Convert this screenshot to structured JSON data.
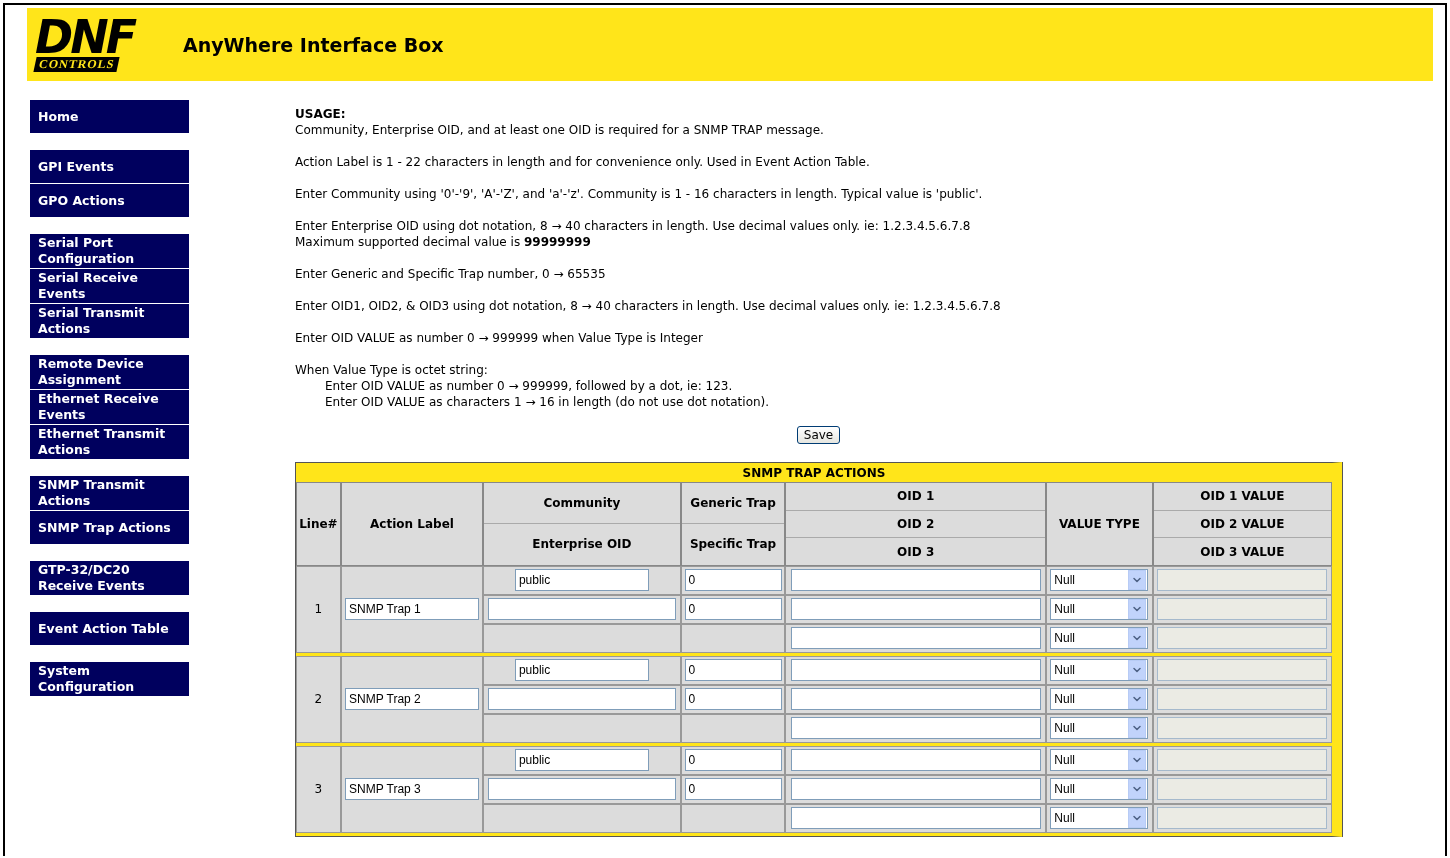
{
  "header": {
    "logo_top": "DNF",
    "logo_bottom": "CONTROLS",
    "title": "AnyWhere Interface Box"
  },
  "sidebar": {
    "groups": [
      [
        "Home"
      ],
      [
        "GPI Events",
        "GPO Actions"
      ],
      [
        "Serial Port Configuration",
        "Serial Receive Events",
        "Serial Transmit Actions"
      ],
      [
        "Remote Device Assignment",
        "Ethernet Receive Events",
        "Ethernet Transmit Actions"
      ],
      [
        "SNMP Transmit Actions",
        "SNMP Trap Actions"
      ],
      [
        "GTP-32/DC20 Receive Events"
      ],
      [
        "Event Action Table"
      ],
      [
        "System Configuration"
      ]
    ]
  },
  "usage": {
    "heading": "USAGE:",
    "paragraphs": [
      {
        "lines": [
          "Community, Enterprise OID, and at least one OID is required for a SNMP TRAP message."
        ]
      },
      {
        "lines": [
          "Action Label is 1 - 22 characters in length and for convenience only. Used in Event Action Table."
        ]
      },
      {
        "lines": [
          "Enter Community using '0'-'9', 'A'-'Z', and 'a'-'z'. Community is 1 - 16 characters in length. Typical value is 'public'."
        ]
      },
      {
        "lines": [
          "Enter Enterprise OID using dot notation, 8 → 40 characters in length. Use decimal values only. ie: 1.2.3.4.5.6.7.8",
          "Maximum supported decimal value is **99999999**"
        ]
      },
      {
        "lines": [
          "Enter Generic and Specific Trap number, 0 → 65535"
        ]
      },
      {
        "lines": [
          "Enter OID1, OID2, & OID3 using dot notation, 8 → 40 characters in length. Use decimal values only. ie: 1.2.3.4.5.6.7.8"
        ]
      },
      {
        "lines": [
          "Enter OID VALUE as number 0 → 999999 when Value Type is Integer"
        ]
      },
      {
        "lines": [
          "When Value Type is octet string:"
        ],
        "sub_lines": [
          "Enter OID VALUE as number 0 → 999999, followed by a dot, ie: 123.",
          "Enter OID VALUE as characters 1 → 16 in length (do not use dot notation)."
        ]
      }
    ]
  },
  "save_button": "Save",
  "table": {
    "title": "SNMP TRAP ACTIONS",
    "columns": [
      {
        "lines": [
          "Line#"
        ]
      },
      {
        "lines": [
          "Action Label"
        ]
      },
      {
        "lines": [
          "Community",
          "Enterprise OID"
        ]
      },
      {
        "lines": [
          "Generic Trap",
          "Specific Trap"
        ]
      },
      {
        "lines": [
          "OID 1",
          "OID 2",
          "OID 3"
        ]
      },
      {
        "lines": [
          "VALUE TYPE"
        ]
      },
      {
        "lines": [
          "OID 1 VALUE",
          "OID 2 VALUE",
          "OID 3 VALUE"
        ]
      }
    ],
    "rows": [
      {
        "line": "1",
        "label": "SNMP Trap 1",
        "community": "public",
        "generic": "0",
        "specific": "0",
        "oids": [
          {
            "type": "Null",
            "value_disabled": true
          },
          {
            "type": "Null",
            "value_disabled": true
          },
          {
            "type": "Null",
            "value_disabled": true
          }
        ]
      },
      {
        "line": "2",
        "label": "SNMP Trap 2",
        "community": "public",
        "generic": "0",
        "specific": "0",
        "oids": [
          {
            "type": "Null",
            "value_disabled": true
          },
          {
            "type": "Null",
            "value_disabled": true
          },
          {
            "type": "Null",
            "value_disabled": true
          }
        ]
      },
      {
        "line": "3",
        "label": "SNMP Trap 3",
        "community": "public",
        "generic": "0",
        "specific": "0",
        "oids": [
          {
            "type": "Null",
            "value_disabled": true
          },
          {
            "type": "Null",
            "value_disabled": true
          },
          {
            "type": "Null",
            "value_disabled": true
          }
        ]
      }
    ]
  }
}
